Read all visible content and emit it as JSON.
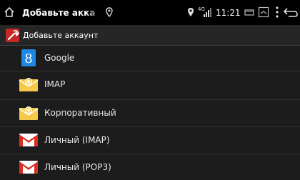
{
  "status_bar": {
    "title": "Добавьте акка",
    "network_label": "4G",
    "time": "11:21"
  },
  "action_bar": {
    "title": "Добавьте аккаунт"
  },
  "accounts": [
    {
      "label": "Google",
      "icon": "google-icon"
    },
    {
      "label": "IMAP",
      "icon": "email-icon"
    },
    {
      "label": "Корпоративный",
      "icon": "email-icon"
    },
    {
      "label": "Личный (IMAP)",
      "icon": "gmail-icon"
    },
    {
      "label": "Личный (POP3)",
      "icon": "gmail-icon"
    }
  ],
  "colors": {
    "background": "#1c1c1c",
    "status_bar": "#000000",
    "action_bar_divider": "#3c4043",
    "google_blue": "#1e88e5",
    "gmail_red": "#d93025",
    "envelope_yellow": "#f7c948"
  }
}
